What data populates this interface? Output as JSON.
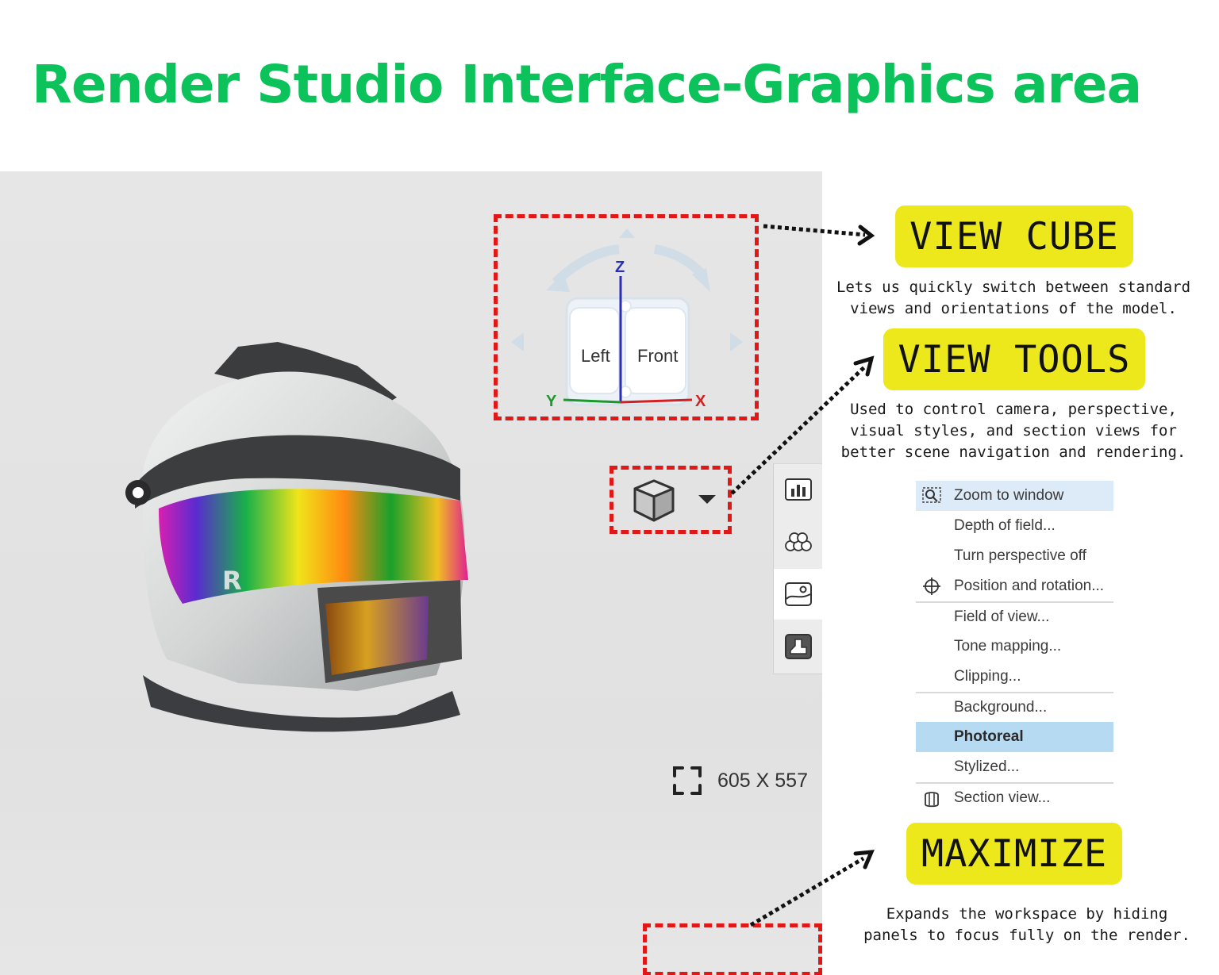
{
  "page_title": "Render Studio Interface-Graphics area",
  "view_cube": {
    "axis_z": "Z",
    "axis_y": "Y",
    "axis_x": "X",
    "face_left": "Left",
    "face_front": "Front"
  },
  "helmet_logo": "R",
  "callouts": {
    "view_cube": {
      "title": "VIEW CUBE",
      "description": "Lets us quickly switch between standard\nviews and orientations of the model."
    },
    "view_tools": {
      "title": "VIEW TOOLS",
      "description": "Used to control camera, perspective,\nvisual styles, and section views for\nbetter scene navigation and rendering."
    },
    "maximize": {
      "title": "MAXIMIZE",
      "description": "Expands the workspace by hiding\npanels to focus fully on the render."
    }
  },
  "view_menu": {
    "items": [
      {
        "label": "Zoom to window",
        "icon": "zoom-window-icon"
      },
      {
        "label": "Depth of field..."
      },
      {
        "label": "Turn perspective off"
      },
      {
        "label": "Position and rotation...",
        "icon": "crosshair-icon"
      },
      {
        "label": "Field of view..."
      },
      {
        "label": "Tone mapping..."
      },
      {
        "label": "Clipping..."
      },
      {
        "label": "Background..."
      },
      {
        "label": "Photoreal"
      },
      {
        "label": "Stylized..."
      },
      {
        "label": "Section view...",
        "icon": "section-view-icon"
      }
    ]
  },
  "side_toolbar": {
    "buttons": [
      {
        "icon": "render-stats-icon"
      },
      {
        "icon": "materials-icon"
      },
      {
        "icon": "environment-icon"
      },
      {
        "icon": "decal-icon"
      }
    ]
  },
  "viewport_size": "605 X 557",
  "colors": {
    "title_green": "#0cc25a",
    "callout_yellow": "#ece81c",
    "dash_red": "#e01818",
    "menu_highlight": "#b6daf2",
    "menu_highlight_light": "#dcebf7"
  }
}
